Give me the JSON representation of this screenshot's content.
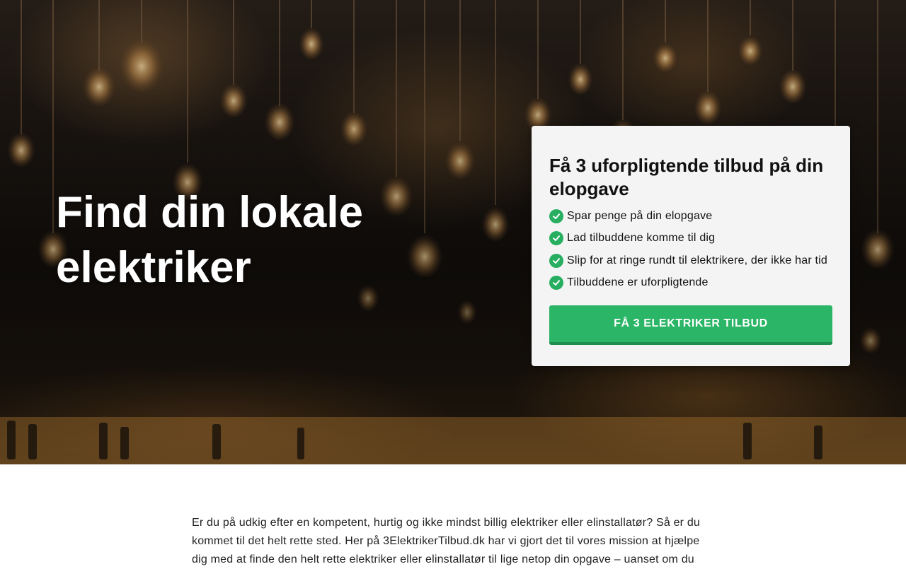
{
  "hero": {
    "title": "Find din lokale elektriker"
  },
  "offer": {
    "title": "Få 3 uforpligtende tilbud på din elopgave",
    "benefits": [
      "Spar penge på din elopgave",
      "Lad tilbuddene komme til dig",
      "Slip for at ringe rundt til elektrikere, der ikke har tid",
      "Tilbuddene er uforpligtende"
    ],
    "cta_label": "FÅ 3 ELEKTRIKER TILBUD"
  },
  "content": {
    "intro": "Er du på udkig efter en kompetent, hurtig og ikke mindst billig elektriker eller elinstallatør? Så er du kommet til det helt rette sted. Her på 3ElektrikerTilbud.dk har vi gjort det til vores mission at hjælpe dig med at finde den helt rette elektriker eller elinstallatør til lige netop din opgave – uanset om du"
  },
  "colors": {
    "accent": "#2bb566",
    "check": "#27ae60",
    "card_bg": "#f4f4f4"
  }
}
